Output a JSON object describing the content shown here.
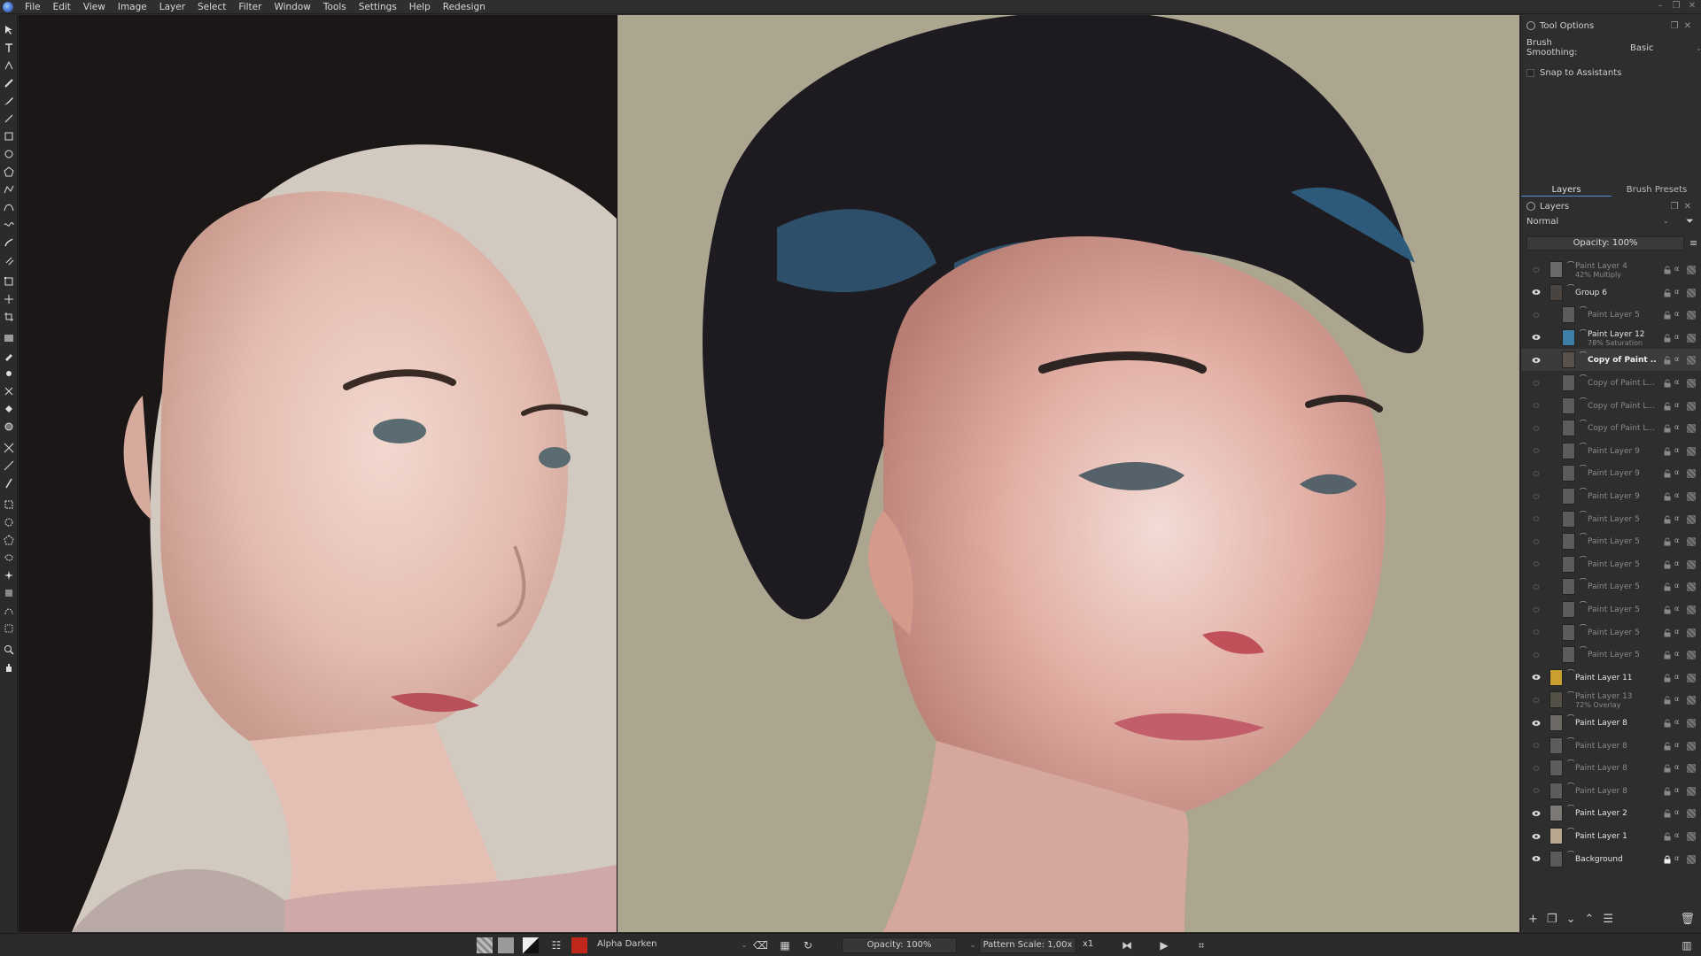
{
  "menubar": {
    "items": [
      "File",
      "Edit",
      "View",
      "Image",
      "Layer",
      "Select",
      "Filter",
      "Window",
      "Tools",
      "Settings",
      "Help",
      "Redesign"
    ]
  },
  "tool_options": {
    "title": "Tool Options",
    "brush_smoothing_label": "Brush Smoothing:",
    "brush_smoothing_value": "Basic",
    "snap_label": "Snap to Assistants"
  },
  "dock_tabs": [
    "Layers",
    "Brush Presets"
  ],
  "layers_panel": {
    "title": "Layers",
    "blend_mode": "Normal",
    "opacity": "Opacity: 100%",
    "layers": [
      {
        "name": "Paint Layer 4",
        "sub": "42% Multiply",
        "visible": false,
        "indent": 0,
        "style": "dim",
        "thumb": "#6a6a6a"
      },
      {
        "name": "Group 6",
        "sub": "",
        "visible": true,
        "indent": 0,
        "style": "bright",
        "thumb": "#4a4440"
      },
      {
        "name": "Paint Layer 5",
        "sub": "",
        "visible": false,
        "indent": 1,
        "style": "dim",
        "thumb": "#5c5c5c"
      },
      {
        "name": "Paint Layer 12",
        "sub": "78% Saturation",
        "visible": true,
        "indent": 1,
        "style": "bright",
        "thumb": "#3d7fa6"
      },
      {
        "name": "Copy of Paint ...",
        "sub": "",
        "visible": true,
        "indent": 1,
        "style": "bold",
        "thumb": "#5b514b"
      },
      {
        "name": "Copy of Paint L...",
        "sub": "",
        "visible": false,
        "indent": 1,
        "style": "dim",
        "thumb": "#5c5c5c"
      },
      {
        "name": "Copy of Paint L...",
        "sub": "",
        "visible": false,
        "indent": 1,
        "style": "dim",
        "thumb": "#5c5c5c"
      },
      {
        "name": "Copy of Paint L...",
        "sub": "",
        "visible": false,
        "indent": 1,
        "style": "dim",
        "thumb": "#5c5c5c"
      },
      {
        "name": "Paint Layer 9",
        "sub": "",
        "visible": false,
        "indent": 1,
        "style": "dim",
        "thumb": "#5c5c5c"
      },
      {
        "name": "Paint Layer 9",
        "sub": "",
        "visible": false,
        "indent": 1,
        "style": "dim",
        "thumb": "#5c5c5c"
      },
      {
        "name": "Paint Layer 9",
        "sub": "",
        "visible": false,
        "indent": 1,
        "style": "dim",
        "thumb": "#5c5c5c"
      },
      {
        "name": "Paint Layer 5",
        "sub": "",
        "visible": false,
        "indent": 1,
        "style": "dim",
        "thumb": "#5c5c5c"
      },
      {
        "name": "Paint Layer 5",
        "sub": "",
        "visible": false,
        "indent": 1,
        "style": "dim",
        "thumb": "#5c5c5c"
      },
      {
        "name": "Paint Layer 5",
        "sub": "",
        "visible": false,
        "indent": 1,
        "style": "dim",
        "thumb": "#5c5c5c"
      },
      {
        "name": "Paint Layer 5",
        "sub": "",
        "visible": false,
        "indent": 1,
        "style": "dim",
        "thumb": "#5c5c5c"
      },
      {
        "name": "Paint Layer 5",
        "sub": "",
        "visible": false,
        "indent": 1,
        "style": "dim",
        "thumb": "#5c5c5c"
      },
      {
        "name": "Paint Layer 5",
        "sub": "",
        "visible": false,
        "indent": 1,
        "style": "dim",
        "thumb": "#5c5c5c"
      },
      {
        "name": "Paint Layer 5",
        "sub": "",
        "visible": false,
        "indent": 1,
        "style": "dim",
        "thumb": "#5c5c5c"
      },
      {
        "name": "Paint Layer 11",
        "sub": "",
        "visible": true,
        "indent": 0,
        "style": "bright",
        "thumb": "#c9a030"
      },
      {
        "name": "Paint Layer 13",
        "sub": "72% Overlay",
        "visible": false,
        "indent": 0,
        "style": "dim",
        "thumb": "#555045"
      },
      {
        "name": "Paint Layer 8",
        "sub": "",
        "visible": true,
        "indent": 0,
        "style": "bright",
        "thumb": "#6d6a66"
      },
      {
        "name": "Paint Layer 8",
        "sub": "",
        "visible": false,
        "indent": 0,
        "style": "dim",
        "thumb": "#5c5c5c"
      },
      {
        "name": "Paint Layer 8",
        "sub": "",
        "visible": false,
        "indent": 0,
        "style": "dim",
        "thumb": "#5c5c5c"
      },
      {
        "name": "Paint Layer 8",
        "sub": "",
        "visible": false,
        "indent": 0,
        "style": "dim",
        "thumb": "#5c5c5c"
      },
      {
        "name": "Paint Layer 2",
        "sub": "",
        "visible": true,
        "indent": 0,
        "style": "bright",
        "thumb": "#7d7a75"
      },
      {
        "name": "Paint Layer 1",
        "sub": "",
        "visible": true,
        "indent": 0,
        "style": "bright",
        "thumb": "#b8a68e"
      },
      {
        "name": "Background",
        "sub": "",
        "visible": true,
        "indent": 0,
        "style": "bright",
        "thumb": "#5a5a5a",
        "locked": true
      }
    ]
  },
  "bottombar": {
    "blend_mode": "Alpha Darken",
    "opacity": "Opacity: 100%",
    "pattern_scale": "Pattern Scale: 1,00x",
    "multiplier": "x1"
  },
  "colors": {
    "accent": "#5a8ed8",
    "foreground_color": "#c0281c",
    "panel_bg": "#2e2e2e"
  }
}
